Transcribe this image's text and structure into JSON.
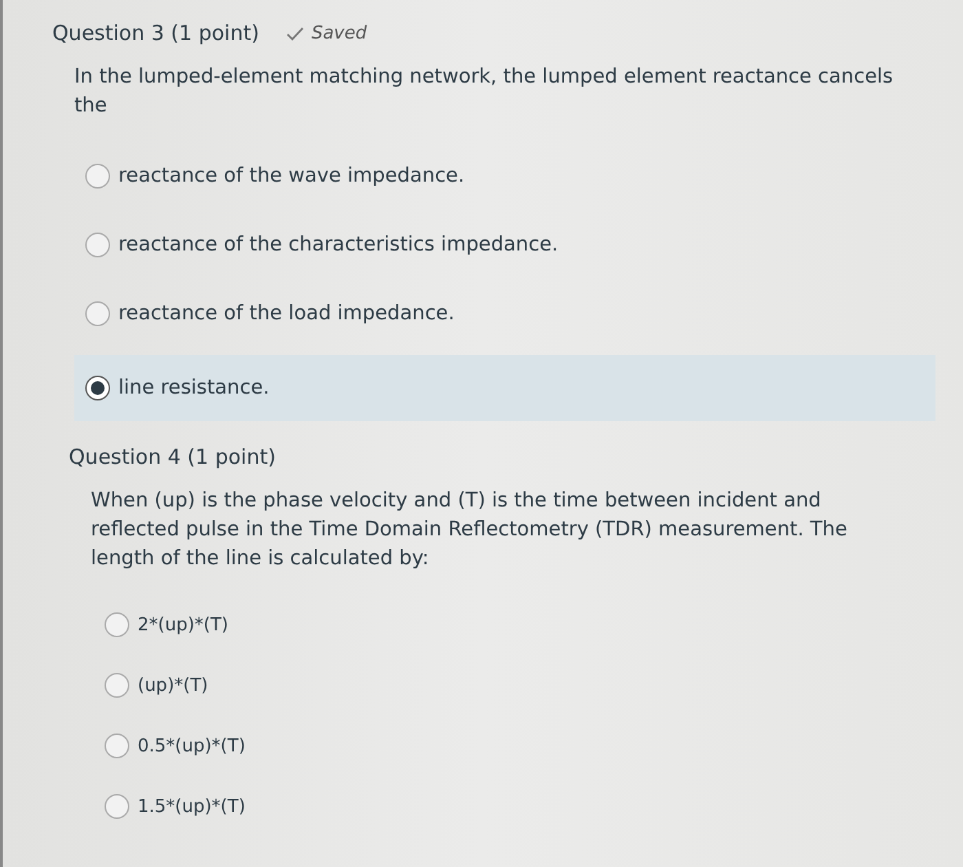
{
  "questions": [
    {
      "title": "Question 3",
      "points": "(1 point)",
      "status": "Saved",
      "text": "In the lumped-element matching network, the lumped element reactance cancels the",
      "options": [
        {
          "label": "reactance of the wave impedance.",
          "selected": false
        },
        {
          "label": "reactance of the characteristics impedance.",
          "selected": false
        },
        {
          "label": "reactance of the load impedance.",
          "selected": false
        },
        {
          "label": "line resistance.",
          "selected": true
        }
      ]
    },
    {
      "title": "Question 4",
      "points": "(1 point)",
      "text": "When (up) is the phase velocity and (T) is the time between incident and reflected pulse in the Time Domain Reflectometry (TDR) measurement. The length of the line is calculated by:",
      "options": [
        {
          "label": "2*(up)*(T)",
          "selected": false
        },
        {
          "label": "(up)*(T)",
          "selected": false
        },
        {
          "label": "0.5*(up)*(T)",
          "selected": false
        },
        {
          "label": "1.5*(up)*(T)",
          "selected": false
        }
      ]
    }
  ]
}
